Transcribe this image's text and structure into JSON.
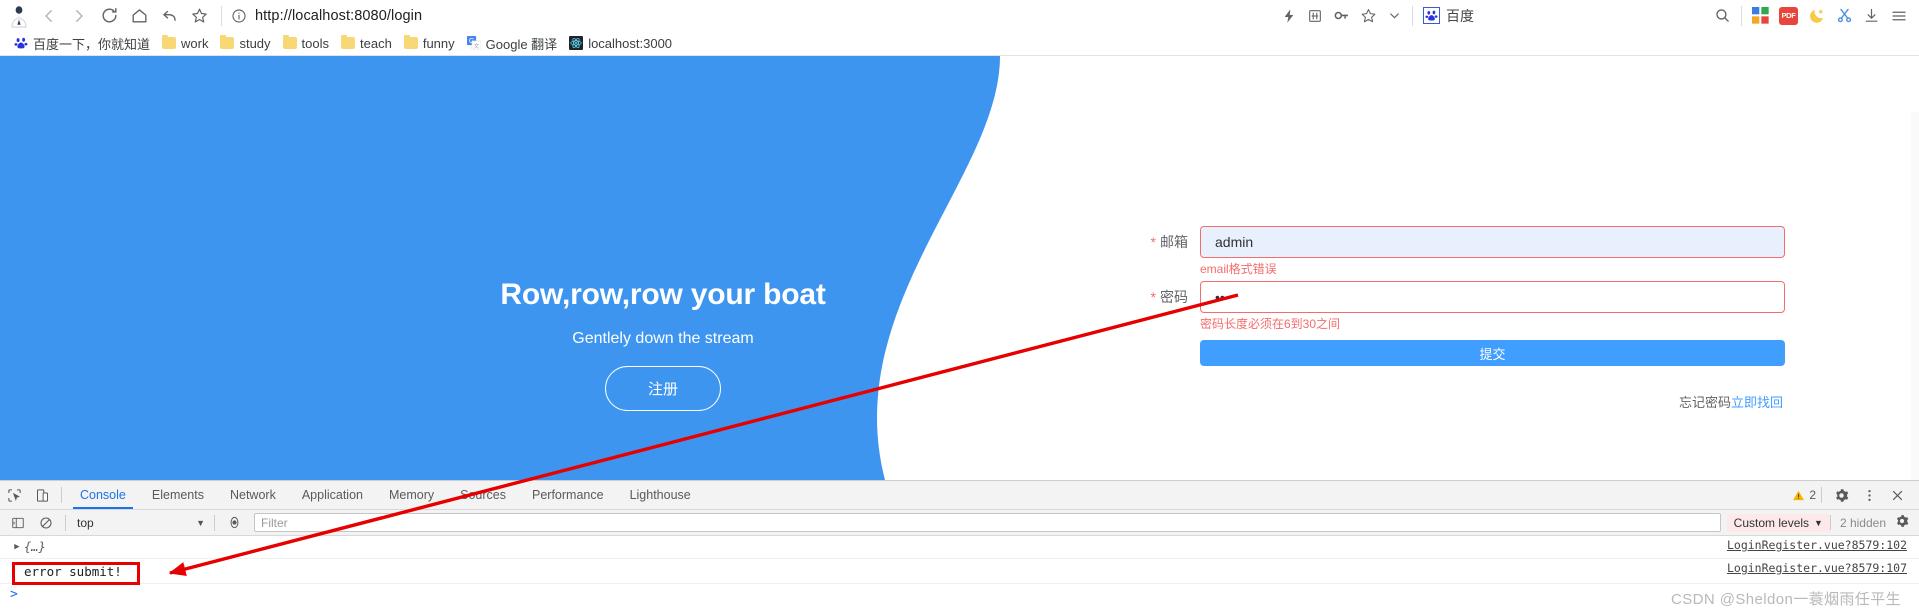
{
  "browser": {
    "url": "http://localhost:8080/login",
    "nav_icons": [
      {
        "name": "back-button",
        "label": "Back"
      },
      {
        "name": "forward-button",
        "label": "Forward"
      },
      {
        "name": "reload-button",
        "label": "Reload"
      },
      {
        "name": "home-button",
        "label": "Home"
      },
      {
        "name": "history-back-button",
        "label": "History"
      },
      {
        "name": "bookmark-star-button",
        "label": "Bookmark"
      }
    ],
    "site_info_label": "Site information",
    "right_icons": [
      {
        "name": "lightning-icon",
        "label": "Quick action"
      },
      {
        "name": "grid-apps-icon",
        "label": "Apps"
      },
      {
        "name": "key-icon",
        "label": "Passwords"
      },
      {
        "name": "star-outline-icon",
        "label": "Add bookmark"
      },
      {
        "name": "chevron-down-icon",
        "label": "More"
      }
    ],
    "search_engine_chip": "百度",
    "extension_icons": [
      {
        "name": "search-icon",
        "label": "Search"
      },
      {
        "name": "colorful-grid-extension-icon",
        "label": "Extension"
      },
      {
        "name": "pdf-extension-icon",
        "label": "PDF"
      },
      {
        "name": "moon-theme-icon",
        "label": "Dark mode"
      },
      {
        "name": "scissors-extension-icon",
        "label": "Capture"
      },
      {
        "name": "downloads-icon",
        "label": "Downloads"
      },
      {
        "name": "menu-icon",
        "label": "Customize and control"
      }
    ]
  },
  "bookmarks": [
    {
      "label": "百度一下，你就知道",
      "icon": "baidu-paw-icon"
    },
    {
      "label": "work",
      "icon": "folder-icon"
    },
    {
      "label": "study",
      "icon": "folder-icon"
    },
    {
      "label": "tools",
      "icon": "folder-icon"
    },
    {
      "label": "teach",
      "icon": "folder-icon"
    },
    {
      "label": "funny",
      "icon": "folder-icon"
    },
    {
      "label": "Google 翻译",
      "icon": "google-translate-icon"
    },
    {
      "label": "localhost:3000",
      "icon": "react-icon"
    }
  ],
  "page": {
    "hero": {
      "title": "Row,row,row your boat",
      "subtitle": "Gentlely down the stream",
      "register_button": "注册",
      "background_color": "#3d95f0"
    },
    "form": {
      "email": {
        "label": "邮箱",
        "required_mark": "*",
        "value": "admin",
        "error": "email格式错误"
      },
      "password": {
        "label": "密码",
        "required_mark": "*",
        "value": "••",
        "error": "密码长度必须在6到30之间"
      },
      "submit_label": "提交",
      "forgot_text": "忘记密码",
      "forgot_link": "立即找回",
      "accent_color": "#409eff",
      "error_color": "#f56c6c"
    }
  },
  "devtools": {
    "tabs": [
      {
        "label": "Console",
        "active": true
      },
      {
        "label": "Elements",
        "active": false
      },
      {
        "label": "Network",
        "active": false
      },
      {
        "label": "Application",
        "active": false
      },
      {
        "label": "Memory",
        "active": false
      },
      {
        "label": "Sources",
        "active": false
      },
      {
        "label": "Performance",
        "active": false
      },
      {
        "label": "Lighthouse",
        "active": false
      }
    ],
    "left_icons": [
      {
        "name": "inspect-element-icon",
        "label": "Inspect"
      },
      {
        "name": "device-toolbar-icon",
        "label": "Toggle device toolbar"
      }
    ],
    "warning_count": "2",
    "right_icons": [
      {
        "name": "settings-gear-icon",
        "label": "Settings"
      },
      {
        "name": "more-options-icon",
        "label": "More options"
      },
      {
        "name": "close-devtools-icon",
        "label": "Close"
      }
    ],
    "filterbar": {
      "context": "top",
      "filter_placeholder": "Filter",
      "filter_value": "",
      "levels_label": "Custom levels",
      "hidden_label": "2 hidden",
      "clear_console_label": "Clear console",
      "sidebar_toggle_label": "Console sidebar",
      "eye_label": "Log XMLHttpRequests"
    },
    "console_rows": [
      {
        "disclosure": "▶",
        "text": "{…}",
        "source": "LoginRegister.vue?8579:102",
        "kind": "object"
      },
      {
        "disclosure": "",
        "text": "error submit!",
        "source": "LoginRegister.vue?8579:107",
        "kind": "log"
      }
    ],
    "prompt": ">"
  },
  "annotation": {
    "highlight_color": "#e60000",
    "watermark": "CSDN @Sheldon一蓑烟雨任平生"
  }
}
